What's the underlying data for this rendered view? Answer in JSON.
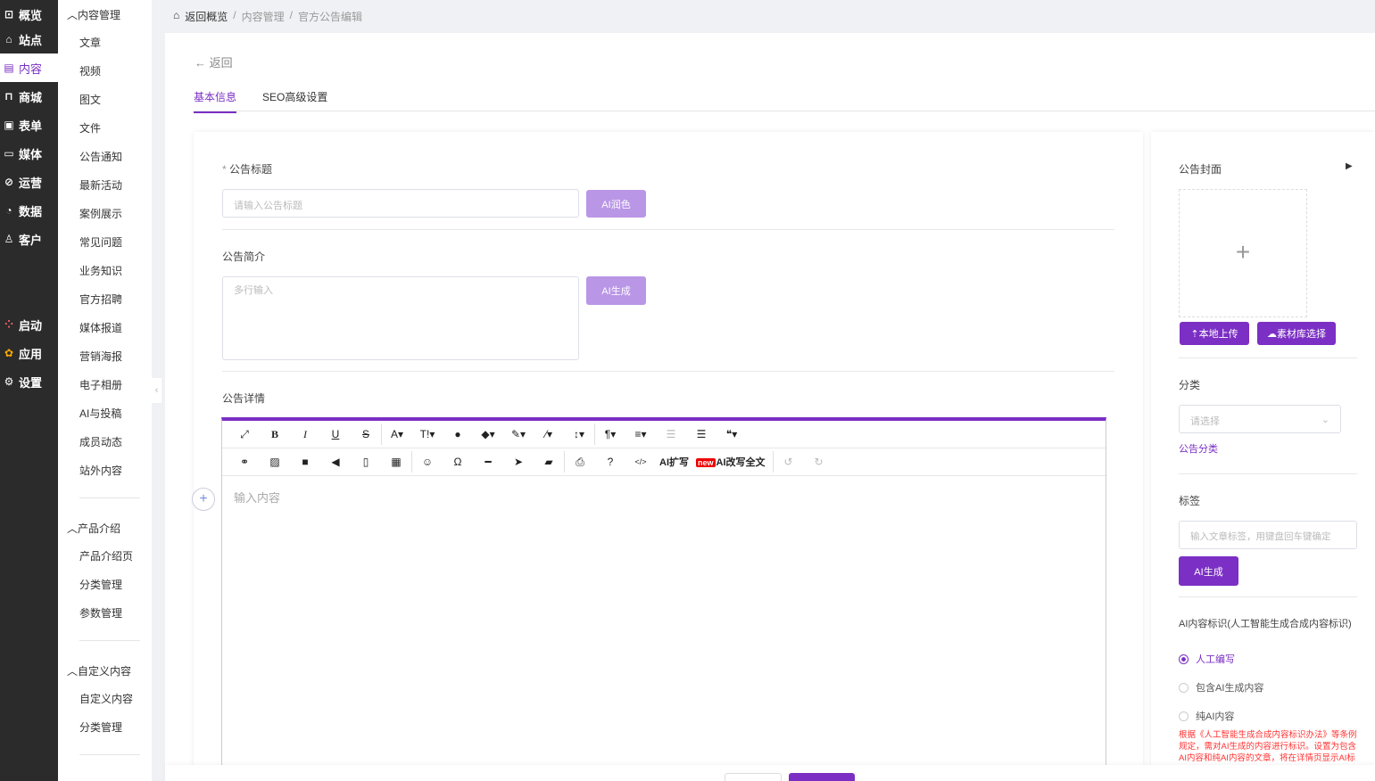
{
  "nav": [
    {
      "icon": "chart-icon",
      "label": "概览"
    },
    {
      "icon": "home-icon",
      "label": "站点"
    },
    {
      "icon": "document-icon",
      "label": "内容"
    },
    {
      "icon": "cart-icon",
      "label": "商城"
    },
    {
      "icon": "form-icon",
      "label": "表单"
    },
    {
      "icon": "media-icon",
      "label": "媒体"
    },
    {
      "icon": "clip-icon",
      "label": "运营"
    },
    {
      "icon": "pie-icon",
      "label": "数据"
    },
    {
      "icon": "user-icon",
      "label": "客户"
    },
    {
      "icon": "launch-icon",
      "label": "启动"
    },
    {
      "icon": "apps-icon",
      "label": "应用"
    },
    {
      "icon": "gear-icon",
      "label": "设置"
    }
  ],
  "sub": {
    "g1": "内容管理",
    "g1items": [
      "文章",
      "视频",
      "图文",
      "文件",
      "公告通知",
      "最新活动",
      "案例展示",
      "常见问题",
      "业务知识",
      "官方招聘",
      "媒体报道",
      "营销海报",
      "电子相册",
      "AI与投稿",
      "成员动态",
      "站外内容"
    ],
    "g2": "产品介绍",
    "g2items": [
      "产品介绍页",
      "分类管理",
      "参数管理"
    ],
    "g3": "自定义内容",
    "g3items": [
      "自定义内容",
      "分类管理"
    ]
  },
  "crumb": [
    "返回概览",
    "内容管理",
    "官方公告编辑"
  ],
  "back": "返回",
  "tabs": [
    "基本信息",
    "SEO高级设置"
  ],
  "form": {
    "title_label": "公告标题",
    "title_ph": "请输入公告标题",
    "ai_polish": "AI润色",
    "intro_label": "公告简介",
    "intro_ph": "多行输入",
    "ai_gen": "AI生成",
    "detail_label": "公告详情",
    "editor_ph": "输入内容",
    "ai_expand": "AI扩写",
    "new_badge": "new",
    "ai_rewrite": "AI改写全文"
  },
  "right": {
    "cover": "公告封面",
    "upload": "本地上传",
    "library": "素材库选择",
    "category": "分类",
    "category_ph": "请选择",
    "category_link": "公告分类",
    "tags": "标签",
    "tags_ph": "输入文章标签，用键盘回车键确定",
    "ai_gen": "AI生成",
    "ai_mark": "AI内容标识(人工智能生成合成内容标识)",
    "radios": [
      "人工编写",
      "包含AI生成内容",
      "纯AI内容"
    ],
    "warn": "根据《人工智能生成合成内容标识办法》等条例规定，需对AI生成的内容进行标识。设置为包含AI内容和纯AI内容的文章，将在详情页显示AI标识"
  }
}
